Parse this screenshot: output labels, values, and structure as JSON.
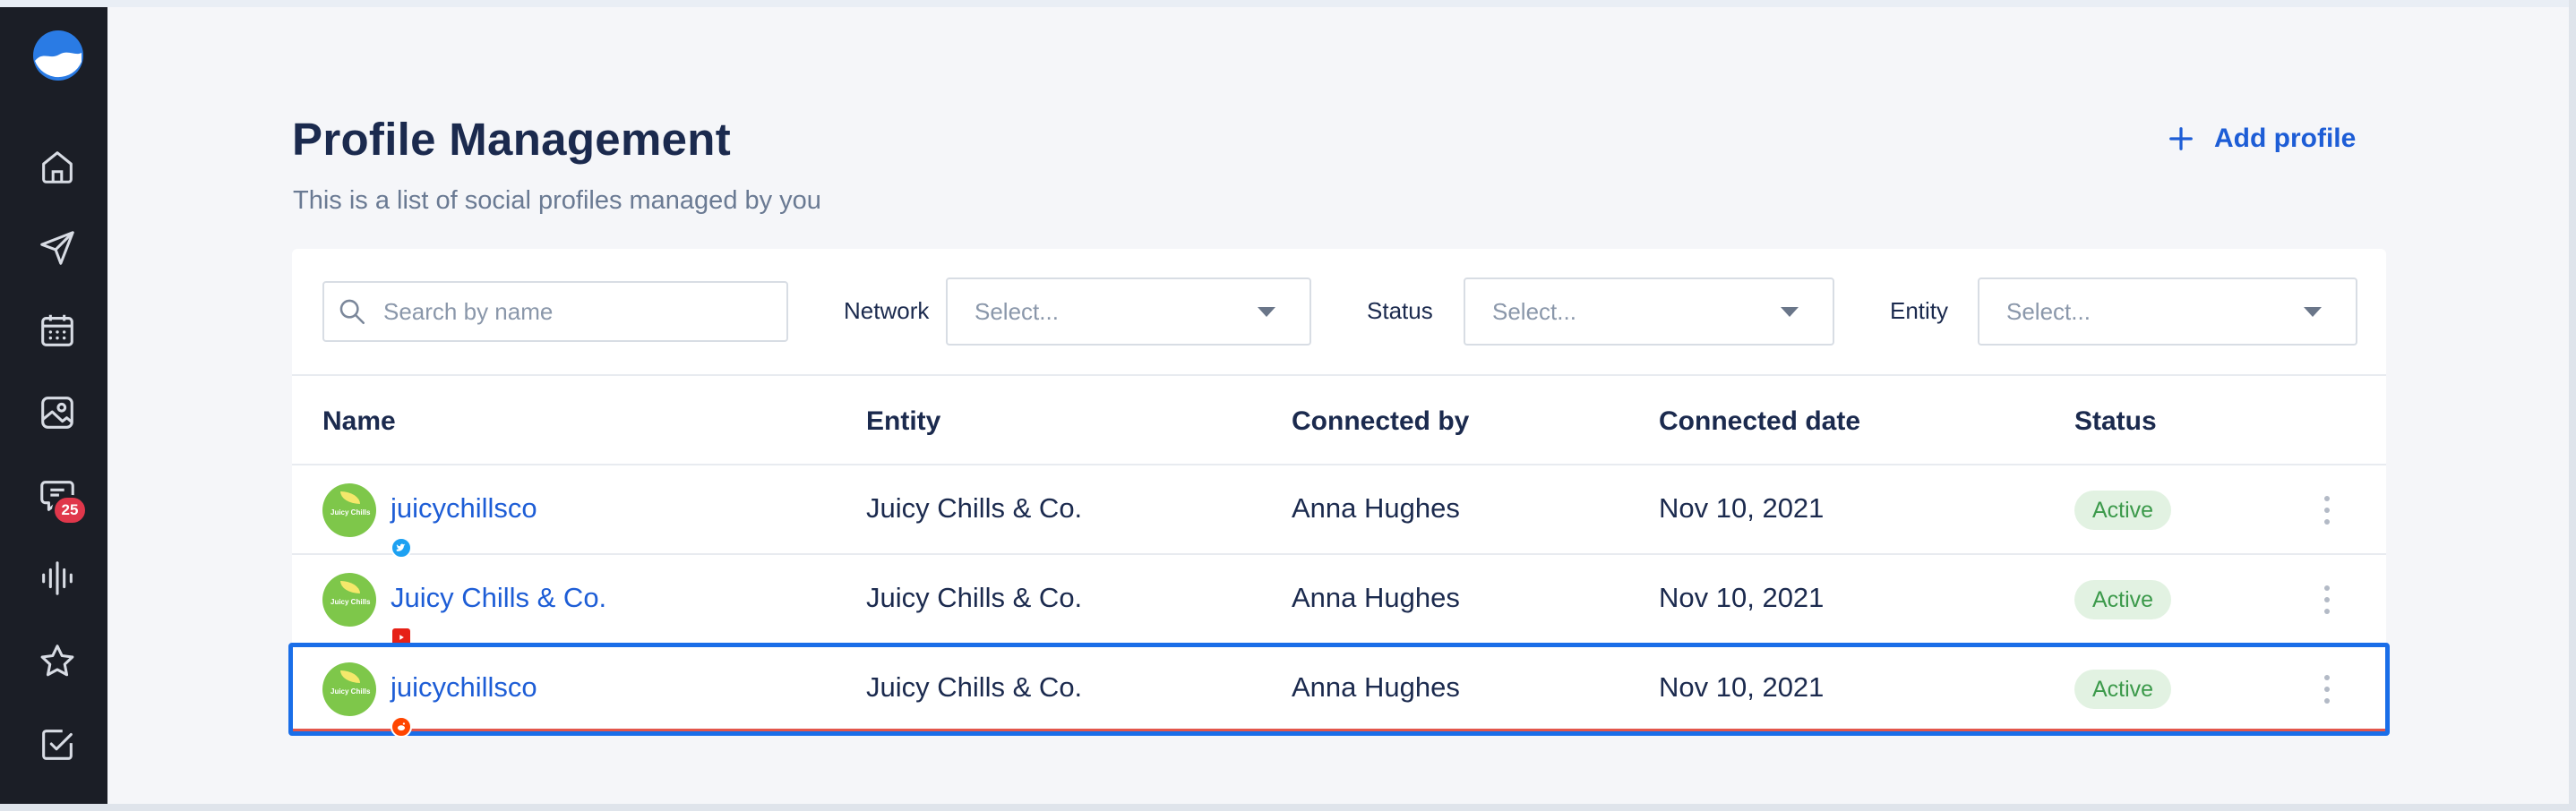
{
  "sidebar": {
    "items": [
      {
        "icon": "home-icon"
      },
      {
        "icon": "send-icon"
      },
      {
        "icon": "calendar-icon"
      },
      {
        "icon": "image-icon"
      },
      {
        "icon": "inbox-icon",
        "badge": "25"
      },
      {
        "icon": "listening-icon"
      },
      {
        "icon": "star-icon"
      },
      {
        "icon": "checkbox-icon"
      }
    ]
  },
  "header": {
    "title": "Profile Management",
    "subtitle": "This is a list of social profiles managed by you",
    "add_label": "Add profile"
  },
  "filters": {
    "search_placeholder": "Search by name",
    "network": {
      "label": "Network",
      "placeholder": "Select..."
    },
    "status": {
      "label": "Status",
      "placeholder": "Select..."
    },
    "entity": {
      "label": "Entity",
      "placeholder": "Select..."
    }
  },
  "table": {
    "columns": [
      "Name",
      "Entity",
      "Connected by",
      "Connected date",
      "Status"
    ],
    "rows": [
      {
        "name": "juicychillsco",
        "network": "twitter",
        "entity": "Juicy Chills & Co.",
        "connected_by": "Anna Hughes",
        "date": "Nov 10, 2021",
        "status": "Active"
      },
      {
        "name": "Juicy Chills & Co.",
        "network": "youtube",
        "entity": "Juicy Chills & Co.",
        "connected_by": "Anna Hughes",
        "date": "Nov 10, 2021",
        "status": "Active"
      },
      {
        "name": "juicychillsco",
        "network": "reddit",
        "entity": "Juicy Chills & Co.",
        "connected_by": "Anna Hughes",
        "date": "Nov 10, 2021",
        "status": "Active"
      }
    ],
    "avatar_text": "Juicy Chills"
  },
  "colors": {
    "accent": "#1d5dd6",
    "sidebar_bg": "#1b1e26",
    "active_bg": "#e2f2e2",
    "active_text": "#3c9a4b",
    "selection": "#1a6ee8",
    "badge": "#e0374b"
  }
}
